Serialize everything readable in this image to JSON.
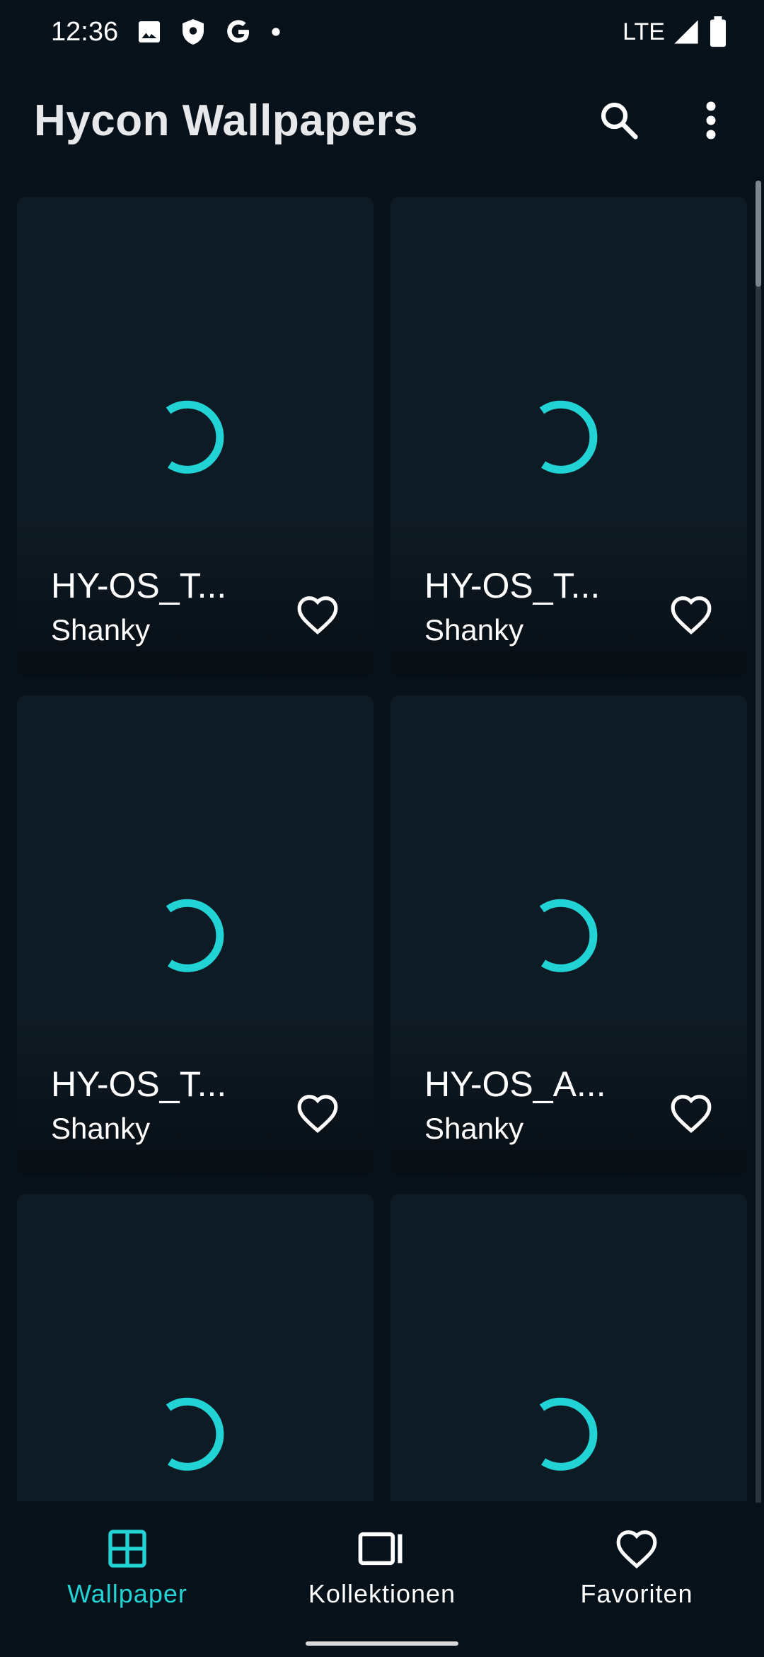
{
  "status_bar": {
    "time": "12:36",
    "network": "LTE",
    "icons": [
      "image-icon",
      "shield-icon",
      "google-icon",
      "dot-icon",
      "signal-icon",
      "battery-icon"
    ]
  },
  "app_bar": {
    "title": "Hycon Wallpapers",
    "actions": [
      "search-icon",
      "more-vert-icon"
    ]
  },
  "colors": {
    "accent": "#22d3d6",
    "background": "#06111a",
    "card": "#0f1b24"
  },
  "wallpapers": [
    {
      "title": "HY-OS_T...",
      "author": "Shanky"
    },
    {
      "title": "HY-OS_T...",
      "author": "Shanky"
    },
    {
      "title": "HY-OS_T...",
      "author": "Shanky"
    },
    {
      "title": "HY-OS_A...",
      "author": "Shanky"
    },
    {
      "title": "",
      "author": ""
    },
    {
      "title": "",
      "author": ""
    }
  ],
  "bottom_nav": {
    "items": [
      {
        "label": "Wallpaper",
        "icon": "grid-icon",
        "active": true
      },
      {
        "label": "Kollektionen",
        "icon": "collections-icon",
        "active": false
      },
      {
        "label": "Favoriten",
        "icon": "heart-icon",
        "active": false
      }
    ]
  }
}
